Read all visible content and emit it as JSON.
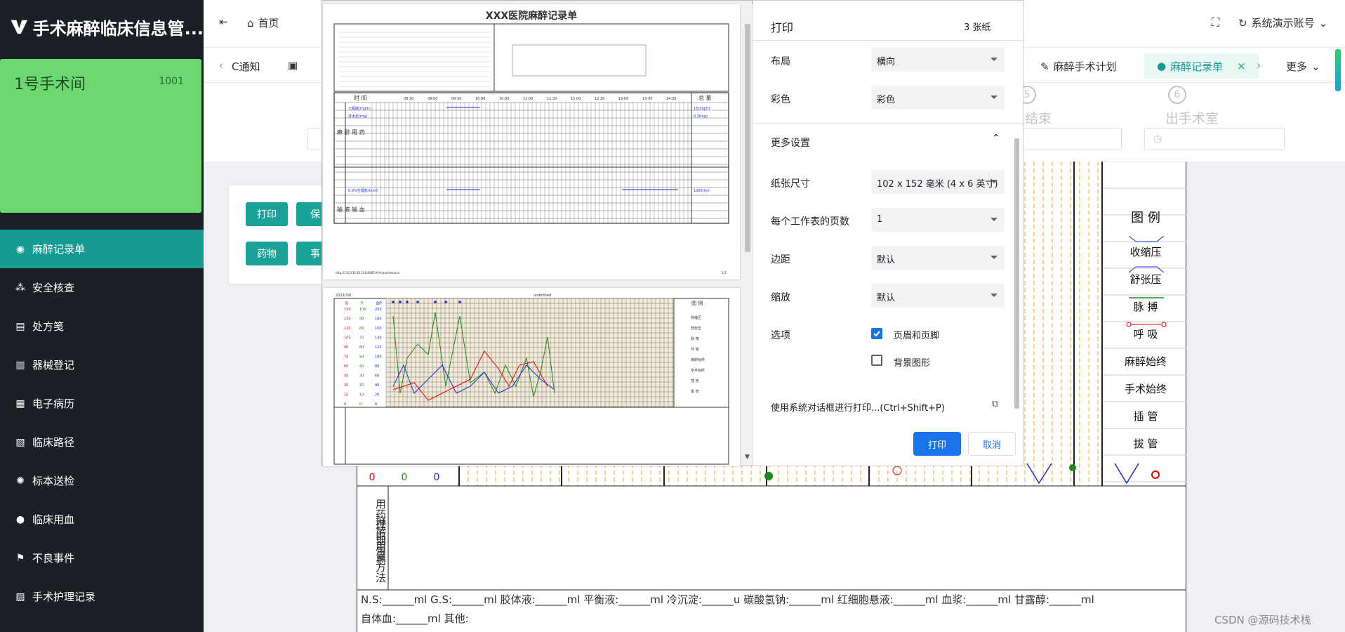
{
  "app": {
    "title": "手术麻醉临床信息管...",
    "room_name": "1号手术间",
    "room_code": "1001"
  },
  "menu": [
    {
      "label": "麻醉记录单",
      "icon": "record-icon"
    },
    {
      "label": "安全核查",
      "icon": "check-icon"
    },
    {
      "label": "处方笺",
      "icon": "prescription-icon"
    },
    {
      "label": "器械登记",
      "icon": "instrument-icon"
    },
    {
      "label": "电子病历",
      "icon": "emr-icon"
    },
    {
      "label": "临床路径",
      "icon": "path-icon"
    },
    {
      "label": "标本送检",
      "icon": "specimen-icon"
    },
    {
      "label": "临床用血",
      "icon": "blood-icon"
    },
    {
      "label": "不良事件",
      "icon": "event-icon"
    },
    {
      "label": "手术护理记录",
      "icon": "nursing-icon"
    }
  ],
  "header": {
    "home": "首页",
    "account": "系统演示账号",
    "more": "更多"
  },
  "tabs": [
    {
      "label": "C通知"
    },
    {
      "label": "麻醉手术计划"
    },
    {
      "label": "麻醉记录单"
    }
  ],
  "steps": [
    {
      "num": "5",
      "label": "结束"
    },
    {
      "num": "6",
      "label": "出手术室"
    }
  ],
  "panel": {
    "print": "打印",
    "save": "保",
    "drug": "药物",
    "event": "事"
  },
  "preview": {
    "title": "XXX医院麻醉记录单",
    "time_label": "时 间",
    "total_label": "总 量",
    "times": [
      "08:30",
      "09:00",
      "09:30",
      "10:00",
      "10:30",
      "11:00",
      "11:30",
      "12:00",
      "12:30",
      "13:00",
      "13:30",
      "14:00"
    ],
    "drug1": "七氟醚(mg/h)",
    "drug1_total": "15(mg/h)",
    "drug2": "芬太尼(mg)",
    "drug2_total": "0.3(mg)",
    "fluid": "0.9%生理盐水(ml)",
    "fluid_total": "1000(ml)",
    "side1": "麻醉用药",
    "side2": "输液输血",
    "footer_url": "http://132.232.82.126:8085/#/Anaesthesiaan",
    "footer_page": "1/3",
    "page2_date": "2023/3/6",
    "page2_undef": "undefined",
    "page2_hdr": [
      "R",
      "P",
      "BP"
    ],
    "page2_legend_title": "图 例",
    "page2_legend": [
      "收缩压",
      "舒张压",
      "脉 搏",
      "呼 吸",
      "麻醉始终",
      "手术始终",
      "插 管",
      "拔 管"
    ]
  },
  "print": {
    "title": "打印",
    "sheets": "3 张纸",
    "layout_label": "布局",
    "layout_value": "横向",
    "color_label": "彩色",
    "color_value": "彩色",
    "more_label": "更多设置",
    "paper_label": "纸张尺寸",
    "paper_value": "102 x 152 毫米 (4 x 6 英寸)",
    "pages_label": "每个工作表的页数",
    "pages_value": "1",
    "margin_label": "边距",
    "margin_value": "默认",
    "scale_label": "缩放",
    "scale_value": "默认",
    "options_label": "选项",
    "opt1": "页眉和页脚",
    "opt2": "背景图形",
    "system_dialog": "使用系统对话框进行打印...(Ctrl+Shift+P)",
    "print_btn": "打印",
    "cancel_btn": "取消"
  },
  "record": {
    "legend_title": "图 例",
    "legend": [
      "收缩压",
      "舒张压",
      "脉 搏",
      "呼 吸",
      "麻醉始终",
      "手术始终",
      "插 管",
      "拔 管"
    ],
    "axis_zero": [
      "0",
      "0",
      "0"
    ],
    "side_label": "麻醉期用药",
    "col_label": "用药理由用量方法",
    "fluids_line1": "N.S:______ml G.S:______ml 胶体液:______ml 平衡液:______ml 冷沉淀:______u 碳酸氢钠:______ml 红细胞悬液:______ml 血浆:______ml 甘露醇:______ml",
    "fluids_line2": "自体血:______ml 其他:"
  },
  "watermark": "CSDN @源码技术栈"
}
